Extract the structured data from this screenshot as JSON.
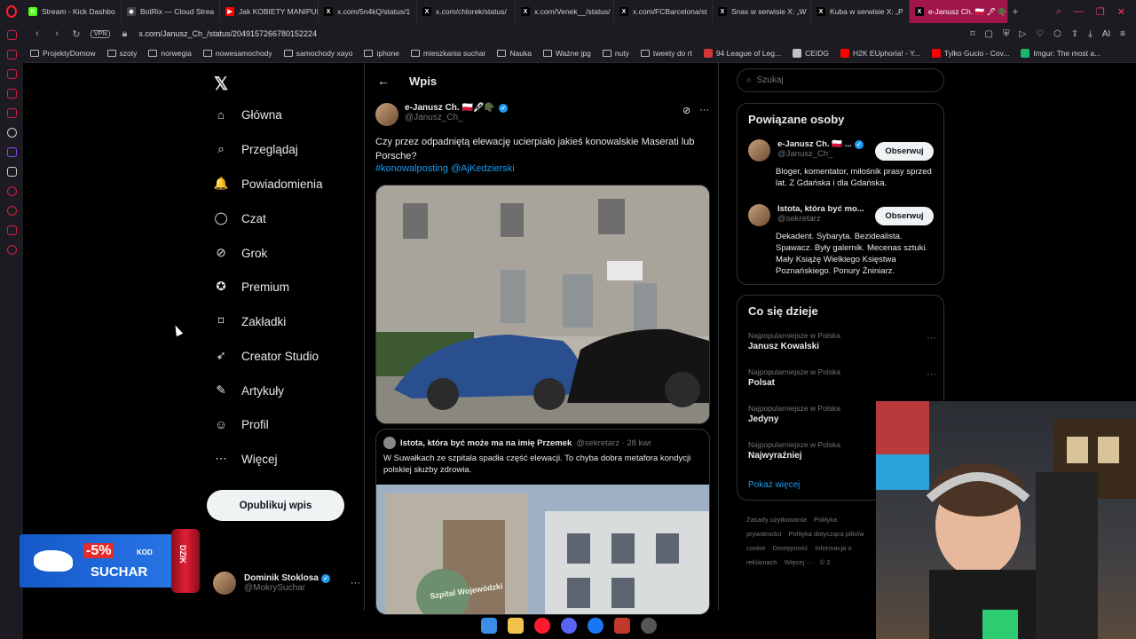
{
  "browser": {
    "tabs": [
      {
        "label": "Stream - Kick Dashbo",
        "fav_color": "#53fc18",
        "fav_char": "K"
      },
      {
        "label": "BotRix — Cloud Strea",
        "fav_color": "#444444",
        "fav_char": "◆"
      },
      {
        "label": "Jak KOBIETY MANIPUL",
        "fav_color": "#ff0000",
        "fav_char": "▶"
      },
      {
        "label": "x.com/5n4kQ/status/1",
        "fav_color": "#000000",
        "fav_char": "X"
      },
      {
        "label": "x.com/chlorek/status/",
        "fav_color": "#000000",
        "fav_char": "X"
      },
      {
        "label": "x.com/Venek__/status/",
        "fav_color": "#000000",
        "fav_char": "X"
      },
      {
        "label": "x.com/FCBarcelona/st",
        "fav_color": "#000000",
        "fav_char": "X"
      },
      {
        "label": "Snax w serwisie X: „W",
        "fav_color": "#000000",
        "fav_char": "X"
      },
      {
        "label": "Kuba w serwisie X: „P",
        "fav_color": "#000000",
        "fav_char": "X"
      },
      {
        "label": "e-Janusz Ch. 🇵🇱 🖋 🪖 w s",
        "fav_color": "#000000",
        "fav_char": "X",
        "active": true
      }
    ],
    "url_domain": "x.com/",
    "url_path": "Janusz_Ch_/status/2049157266780152224",
    "vpn_label": "VPN",
    "addr_ai": "AI",
    "bookmarks": [
      {
        "label": "ProjektyDomow",
        "type": "folder"
      },
      {
        "label": "szoty",
        "type": "folder"
      },
      {
        "label": "norwegia",
        "type": "folder"
      },
      {
        "label": "nowesamochody",
        "type": "folder"
      },
      {
        "label": "samochody xayo",
        "type": "folder"
      },
      {
        "label": "iphone",
        "type": "folder"
      },
      {
        "label": "mieszkania suchar",
        "type": "folder"
      },
      {
        "label": "Nauka",
        "type": "folder"
      },
      {
        "label": "Ważne jpg",
        "type": "folder"
      },
      {
        "label": "nuty",
        "type": "folder"
      },
      {
        "label": "tweety do rt",
        "type": "folder"
      },
      {
        "label": "94 League of Leg...",
        "type": "site",
        "color": "#d13639"
      },
      {
        "label": "CEIDG",
        "type": "site",
        "color": "#c0c0c0"
      },
      {
        "label": "H2K EUphoria! - Y...",
        "type": "site",
        "color": "#ff0000"
      },
      {
        "label": "Tylko Gucio - Cov...",
        "type": "site",
        "color": "#ff0000"
      },
      {
        "label": "Imgur: The most a...",
        "type": "site",
        "color": "#1bb76e"
      }
    ]
  },
  "nav": {
    "items": [
      {
        "label": "Główna",
        "icon": "home-icon",
        "glyph": "⌂"
      },
      {
        "label": "Przeglądaj",
        "icon": "search-icon",
        "glyph": "⌕"
      },
      {
        "label": "Powiadomienia",
        "icon": "bell-icon",
        "glyph": "🔔"
      },
      {
        "label": "Czat",
        "icon": "chat-icon",
        "glyph": "◯"
      },
      {
        "label": "Grok",
        "icon": "grok-icon",
        "glyph": "⊘"
      },
      {
        "label": "Premium",
        "icon": "premium-icon",
        "glyph": "✪"
      },
      {
        "label": "Zakładki",
        "icon": "bookmark-icon",
        "glyph": "⌑"
      },
      {
        "label": "Creator Studio",
        "icon": "rocket-icon",
        "glyph": "➶"
      },
      {
        "label": "Artykuły",
        "icon": "article-icon",
        "glyph": "✎"
      },
      {
        "label": "Profil",
        "icon": "profile-icon",
        "glyph": "☺"
      },
      {
        "label": "Więcej",
        "icon": "more-icon",
        "glyph": "⋯"
      }
    ],
    "post_button": "Opublikuj wpis",
    "user": {
      "name": "Dominik Stoklosa",
      "handle": "@MokrySuchar"
    }
  },
  "promo": {
    "discount": "-5%",
    "kod": "KOD",
    "code": "SUCHAR",
    "can_label": "DZIK"
  },
  "main": {
    "header_title": "Wpis",
    "tweet": {
      "author_name": "e-Janusz Ch. 🇵🇱🖋🪖",
      "author_handle": "@Janusz_Ch_",
      "text": "Czy przez odpadniętą elewację ucierpiało jakieś konowalskie Maserati lub Porsche?",
      "tags": "#konowalposting @AjKedzierski"
    },
    "quote": {
      "author_name": "Istota, która być może ma na imię Przemek",
      "meta": "@sekretarz · 28 kwi",
      "text": "W Suwałkach ze szpitala spadła część elewacji. To chyba dobra metafora kondycji polskiej służby zdrowia.",
      "sign_text": "Szpital Wojewódzki"
    }
  },
  "right": {
    "search_placeholder": "Szukaj",
    "related_title": "Powiązane osoby",
    "related": [
      {
        "name": "e-Janusz Ch. 🇵🇱 ...",
        "handle": "@Janusz_Ch_",
        "bio": "Bloger, komentator, miłośnik prasy sprzed lat. Z Gdańska i dla Gdańska.",
        "follow": "Obserwuj",
        "verified": true
      },
      {
        "name": "Istota, która być mo...",
        "handle": "@sekretarz",
        "bio": "Dekadent. Sybaryta. Bezidealista. Spawacz. Były galernik. Mecenas sztuki. Mały Książę Wielkiego Księstwa Poznańskiego. Ponury Żniniarz.",
        "follow": "Obserwuj",
        "verified": false
      }
    ],
    "trends_title": "Co się dzieje",
    "trends": [
      {
        "context": "Najpopularniejsze w Polska",
        "name": "Janusz Kowalski"
      },
      {
        "context": "Najpopularniejsze w Polska",
        "name": "Polsat"
      },
      {
        "context": "Najpopularniejsze w Polska",
        "name": "Jedyny"
      },
      {
        "context": "Najpopularniejsze w Polska",
        "name": "Najwyraźniej"
      }
    ],
    "show_more": "Pokaż więcej",
    "footer": [
      "Zasady użytkowania",
      "Polityka prywatności",
      "Polityka dotycząca plików cookie",
      "Dostępność",
      "Informacja o reklamach",
      "Więcej ···",
      "© 2"
    ]
  },
  "colors": {
    "accent": "#1d9bf0",
    "active_tab": "#a0154a",
    "opera_red": "#ff1b2d"
  }
}
